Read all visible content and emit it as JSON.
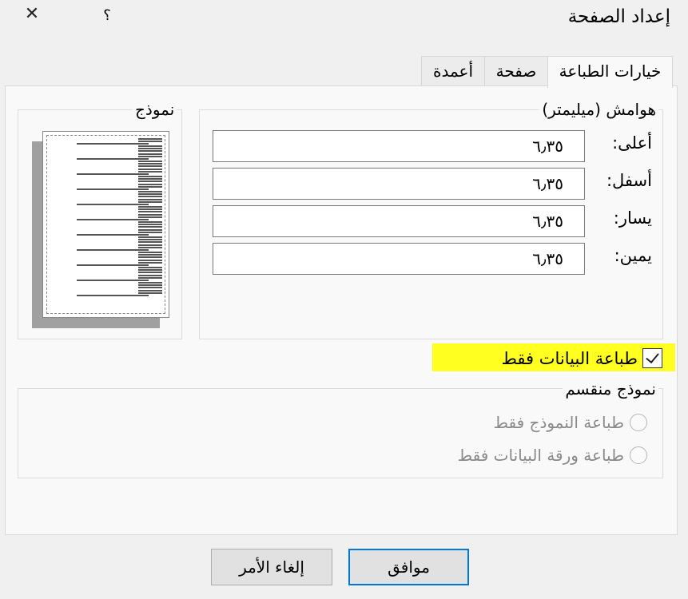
{
  "dialog": {
    "title": "إعداد الصفحة",
    "help_label": "؟",
    "close_label": "✕"
  },
  "tabs": [
    {
      "label": "خيارات الطباعة",
      "active": true
    },
    {
      "label": "صفحة",
      "active": false
    },
    {
      "label": "أعمدة",
      "active": false
    }
  ],
  "margins": {
    "group_label": "هوامش (ميليمتر)",
    "top": {
      "label": "أعلى:",
      "value": "٦٫٣٥"
    },
    "bottom": {
      "label": "أسفل:",
      "value": "٦٫٣٥"
    },
    "left": {
      "label": "يسار:",
      "value": "٦٫٣٥"
    },
    "right": {
      "label": "يمين:",
      "value": "٦٫٣٥"
    }
  },
  "preview": {
    "group_label": "نموذج"
  },
  "print_data_only": {
    "label": "طباعة البيانات فقط",
    "checked": true,
    "highlight_color": "#ffff20"
  },
  "split_form": {
    "group_label": "نموذج منقسم",
    "options": [
      {
        "label": "طباعة النموذج فقط",
        "enabled": false
      },
      {
        "label": "طباعة ورقة البيانات فقط",
        "enabled": false
      }
    ]
  },
  "buttons": {
    "ok": "موافق",
    "cancel": "إلغاء الأمر"
  },
  "colors": {
    "accent": "#0078d7",
    "background": "#f0f0f0"
  }
}
